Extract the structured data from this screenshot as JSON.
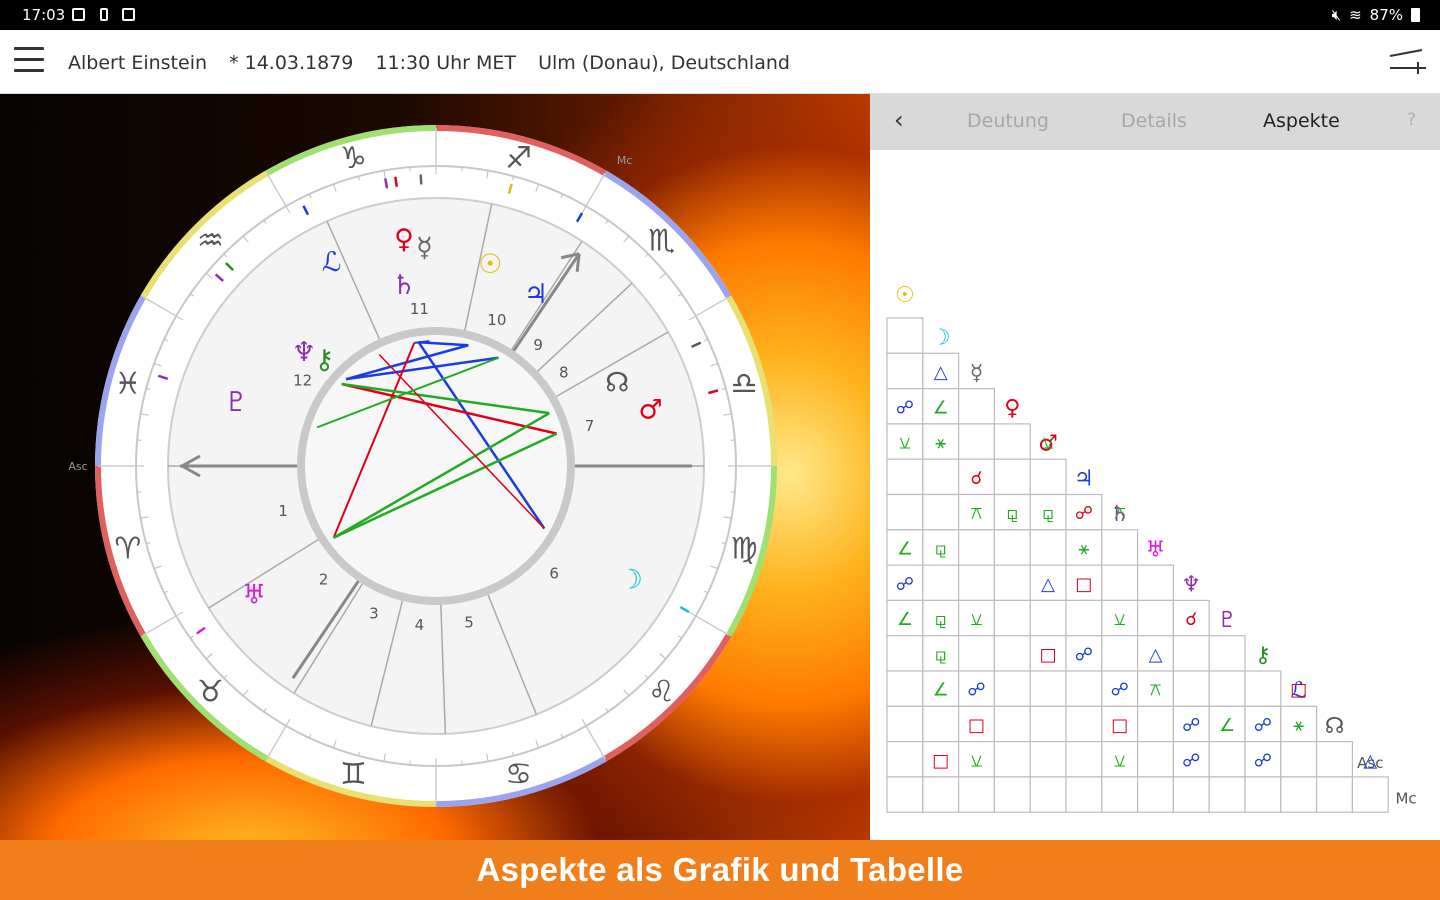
{
  "status": {
    "time": "17:03",
    "battery": "87%"
  },
  "header": {
    "name": "Albert Einstein",
    "birth_date": "* 14.03.1879",
    "birth_time": "11:30 Uhr MET",
    "birth_place": "Ulm (Donau),  Deutschland"
  },
  "tabs": {
    "t1": "Deutung",
    "t2": "Details",
    "t3": "Aspekte",
    "help": "?"
  },
  "banner": {
    "text": "Aspekte als Grafik und Tabelle"
  },
  "wheel": {
    "asc_label": "Asc",
    "mc_label": "Mc",
    "house_numbers": [
      "1",
      "2",
      "3",
      "4",
      "5",
      "6",
      "7",
      "8",
      "9",
      "10",
      "11",
      "12"
    ],
    "zodiac_signs": [
      {
        "g": "♈",
        "c": "#555"
      },
      {
        "g": "♉",
        "c": "#555"
      },
      {
        "g": "♊",
        "c": "#555"
      },
      {
        "g": "♋",
        "c": "#555"
      },
      {
        "g": "♌",
        "c": "#555"
      },
      {
        "g": "♍",
        "c": "#555"
      },
      {
        "g": "♎",
        "c": "#555"
      },
      {
        "g": "♏",
        "c": "#555"
      },
      {
        "g": "♐",
        "c": "#555"
      },
      {
        "g": "♑",
        "c": "#555"
      },
      {
        "g": "♒",
        "c": "#555"
      },
      {
        "g": "♓",
        "c": "#555"
      }
    ],
    "planets": [
      {
        "g": "☉",
        "c": "#e0c000"
      },
      {
        "g": "☿",
        "c": "#666"
      },
      {
        "g": "♀",
        "c": "#e0001a"
      },
      {
        "g": "♄",
        "c": "#8c2fb0"
      },
      {
        "g": "♃",
        "c": "#1a3ce0"
      },
      {
        "g": "♂",
        "c": "#e0001a"
      },
      {
        "g": "☽",
        "c": "#12c4dc"
      },
      {
        "g": "♅",
        "c": "#d61cd6"
      },
      {
        "g": "⚷",
        "c": "#2a8a2a"
      },
      {
        "g": "♇",
        "c": "#8c2fb0"
      },
      {
        "g": "♆",
        "c": "#8c2fb0"
      },
      {
        "g": "ℒ",
        "c": "#1a3ce0"
      },
      {
        "g": "☊",
        "c": "#555"
      }
    ]
  },
  "aspect_table": {
    "row_labels": [
      {
        "g": "☉",
        "c": "#e0c000"
      },
      {
        "g": "☽",
        "c": "#12c4dc"
      },
      {
        "g": "☿",
        "c": "#666666"
      },
      {
        "g": "♀",
        "c": "#e0001a"
      },
      {
        "g": "♂",
        "c": "#e0001a"
      },
      {
        "g": "♃",
        "c": "#1a3ce0"
      },
      {
        "g": "♄",
        "c": "#8c2fb0"
      },
      {
        "g": "♅",
        "c": "#d61cd6"
      },
      {
        "g": "♆",
        "c": "#8c2fb0"
      },
      {
        "g": "♇",
        "c": "#8c2fb0"
      },
      {
        "g": "⚷",
        "c": "#2a8a2a"
      },
      {
        "g": "ℒ",
        "c": "#1a3ce0"
      },
      {
        "g": "☊",
        "c": "#555555"
      },
      {
        "g": "Asc",
        "c": "#555555"
      },
      {
        "g": "Mc",
        "c": "#555555"
      }
    ],
    "cells": [
      {
        "r": 2,
        "c": 1,
        "g": "△",
        "col": "#1a3ce0"
      },
      {
        "r": 3,
        "c": 0,
        "g": "☍",
        "col": "#1a3ce0"
      },
      {
        "r": 3,
        "c": 1,
        "g": "∠",
        "col": "#22aa22"
      },
      {
        "r": 4,
        "c": 0,
        "g": "⚺",
        "col": "#22aa22"
      },
      {
        "r": 4,
        "c": 1,
        "g": "⚹",
        "col": "#22aa22"
      },
      {
        "r": 4,
        "c": 4,
        "g": "⚺",
        "col": "#22aa22"
      },
      {
        "r": 5,
        "c": 2,
        "g": "☌",
        "col": "#e0001a"
      },
      {
        "r": 6,
        "c": 2,
        "g": "⚻",
        "col": "#22aa22"
      },
      {
        "r": 6,
        "c": 3,
        "g": "⚼",
        "col": "#22aa22"
      },
      {
        "r": 6,
        "c": 4,
        "g": "⚼",
        "col": "#22aa22"
      },
      {
        "r": 6,
        "c": 5,
        "g": "☍",
        "col": "#e0001a"
      },
      {
        "r": 6,
        "c": 6,
        "g": "⚻",
        "col": "#22aa22"
      },
      {
        "r": 7,
        "c": 0,
        "g": "∠",
        "col": "#22aa22"
      },
      {
        "r": 7,
        "c": 1,
        "g": "⚼",
        "col": "#22aa22"
      },
      {
        "r": 7,
        "c": 5,
        "g": "⚹",
        "col": "#22aa22"
      },
      {
        "r": 8,
        "c": 0,
        "g": "☍",
        "col": "#1a3ce0"
      },
      {
        "r": 8,
        "c": 4,
        "g": "△",
        "col": "#1a3ce0"
      },
      {
        "r": 8,
        "c": 5,
        "g": "□",
        "col": "#e0001a"
      },
      {
        "r": 9,
        "c": 0,
        "g": "∠",
        "col": "#22aa22"
      },
      {
        "r": 9,
        "c": 1,
        "g": "⚼",
        "col": "#22aa22"
      },
      {
        "r": 9,
        "c": 2,
        "g": "⚺",
        "col": "#22aa22"
      },
      {
        "r": 9,
        "c": 6,
        "g": "⚺",
        "col": "#22aa22"
      },
      {
        "r": 9,
        "c": 8,
        "g": "☌",
        "col": "#e0001a"
      },
      {
        "r": 10,
        "c": 1,
        "g": "⚼",
        "col": "#22aa22"
      },
      {
        "r": 10,
        "c": 4,
        "g": "□",
        "col": "#e0001a"
      },
      {
        "r": 10,
        "c": 5,
        "g": "☍",
        "col": "#1a3ce0"
      },
      {
        "r": 10,
        "c": 7,
        "g": "△",
        "col": "#1a3ce0"
      },
      {
        "r": 11,
        "c": 1,
        "g": "∠",
        "col": "#22aa22"
      },
      {
        "r": 11,
        "c": 2,
        "g": "☍",
        "col": "#1a3ce0"
      },
      {
        "r": 11,
        "c": 6,
        "g": "☍",
        "col": "#1a3ce0"
      },
      {
        "r": 11,
        "c": 7,
        "g": "⚻",
        "col": "#22aa22"
      },
      {
        "r": 11,
        "c": 11,
        "g": "□",
        "col": "#e0001a"
      },
      {
        "r": 12,
        "c": 2,
        "g": "□",
        "col": "#e0001a"
      },
      {
        "r": 12,
        "c": 6,
        "g": "□",
        "col": "#e0001a"
      },
      {
        "r": 12,
        "c": 8,
        "g": "☍",
        "col": "#1a3ce0"
      },
      {
        "r": 12,
        "c": 9,
        "g": "∠",
        "col": "#22aa22"
      },
      {
        "r": 12,
        "c": 10,
        "g": "☍",
        "col": "#1a3ce0"
      },
      {
        "r": 12,
        "c": 11,
        "g": "⚹",
        "col": "#22aa22"
      },
      {
        "r": 13,
        "c": 1,
        "g": "□",
        "col": "#e0001a"
      },
      {
        "r": 13,
        "c": 2,
        "g": "⚺",
        "col": "#22aa22"
      },
      {
        "r": 13,
        "c": 6,
        "g": "⚺",
        "col": "#22aa22"
      },
      {
        "r": 13,
        "c": 8,
        "g": "☍",
        "col": "#1a3ce0"
      },
      {
        "r": 13,
        "c": 10,
        "g": "☍",
        "col": "#1a3ce0"
      },
      {
        "r": 13,
        "c": 13,
        "g": "△",
        "col": "#1a3ce0"
      }
    ]
  }
}
